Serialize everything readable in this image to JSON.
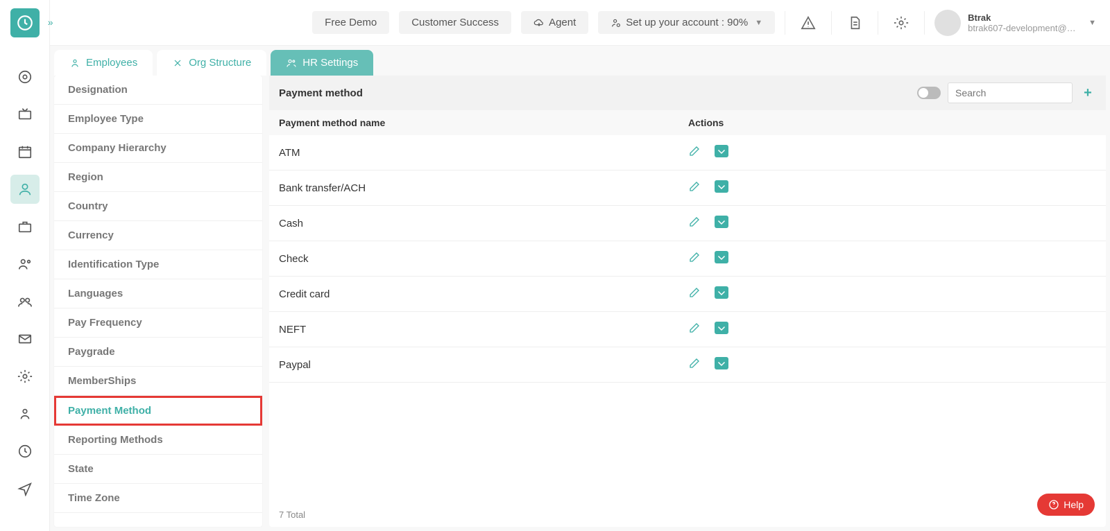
{
  "header": {
    "buttons": {
      "freeDemo": "Free Demo",
      "customerSuccess": "Customer Success",
      "agent": "Agent",
      "setup": "Set up your account : 90%"
    },
    "user": {
      "name": "Btrak",
      "email": "btrak607-development@gm..."
    }
  },
  "tabs": {
    "employees": "Employees",
    "orgStructure": "Org Structure",
    "hrSettings": "HR Settings"
  },
  "settingsMenu": [
    "Designation",
    "Employee Type",
    "Company Hierarchy",
    "Region",
    "Country",
    "Currency",
    "Identification Type",
    "Languages",
    "Pay Frequency",
    "Paygrade",
    "MemberShips",
    "Payment Method",
    "Reporting Methods",
    "State",
    "Time Zone"
  ],
  "content": {
    "title": "Payment method",
    "searchPlaceholder": "Search",
    "columns": {
      "name": "Payment method name",
      "actions": "Actions"
    },
    "rows": [
      "ATM",
      "Bank transfer/ACH",
      "Cash",
      "Check",
      "Credit card",
      "NEFT",
      "Paypal"
    ],
    "footer": "7 Total"
  },
  "help": "Help"
}
